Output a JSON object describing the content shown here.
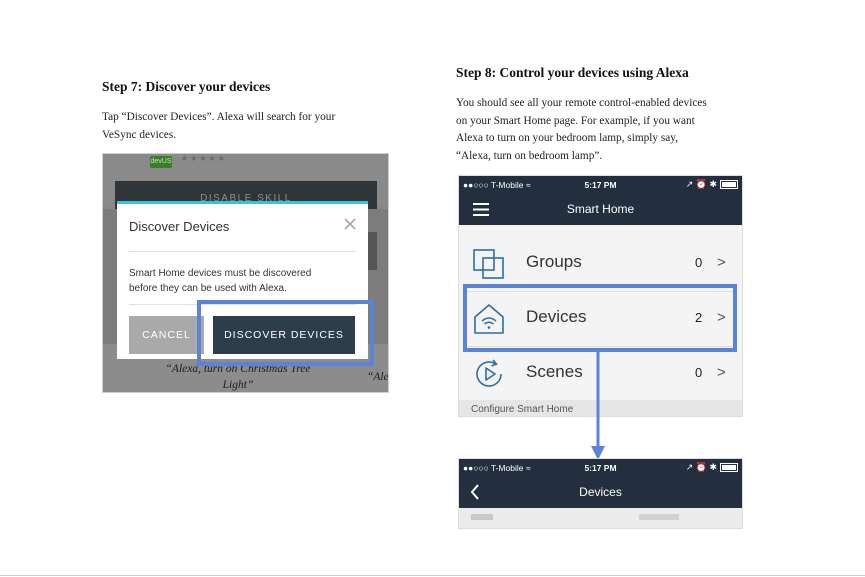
{
  "step7": {
    "heading": "Step 7: Discover your devices",
    "body": [
      "Tap “Discover Devices”. Alexa will search for your",
      "VeSync devices."
    ],
    "screenshot": {
      "badge": "devUS",
      "disable_button": "DISABLE SKILL",
      "dialog": {
        "title": "Discover Devices",
        "message": [
          "Smart Home devices must be discovered",
          "before they can be used with Alexa."
        ],
        "cancel_label": "CANCEL",
        "discover_label": "DISCOVER DEVICES",
        "close_icon": "close-icon"
      },
      "quote_left": [
        "“Alexa, turn on Christmas Tree",
        "Light”"
      ],
      "quote_right": "“Ale"
    }
  },
  "step8": {
    "heading": "Step 8: Control your devices using Alexa",
    "body": [
      "You should see all your remote control-enabled devices",
      "on your Smart Home page. For example, if you want",
      "Alexa to turn on your bedroom lamp, simply say,",
      "“Alexa, turn on bedroom lamp”."
    ],
    "screen1": {
      "carrier": "●●○○○ T-Mobile ≈",
      "time": "5:17 PM",
      "status_right": "↗ ⏰ ✱",
      "title": "Smart Home",
      "menu_icon": "hamburger-menu-icon",
      "rows": [
        {
          "label": "Groups",
          "count": "0",
          "icon": "groups-icon"
        },
        {
          "label": "Devices",
          "count": "2",
          "icon": "smart-home-device-icon"
        },
        {
          "label": "Scenes",
          "count": "0",
          "icon": "scenes-icon"
        }
      ],
      "footer": "Configure Smart Home"
    },
    "screen2": {
      "carrier": "●●○○○ T-Mobile ≈",
      "time": "5:17 PM",
      "status_right": "↗ ⏰ ✱",
      "title": "Devices",
      "back_icon": "back-chevron-icon"
    }
  },
  "colors": {
    "highlight": "#5b84d8",
    "alexa_header": "#232f3e",
    "dialog_accent": "#35c3e0",
    "discover_button": "#2d3e4a"
  }
}
